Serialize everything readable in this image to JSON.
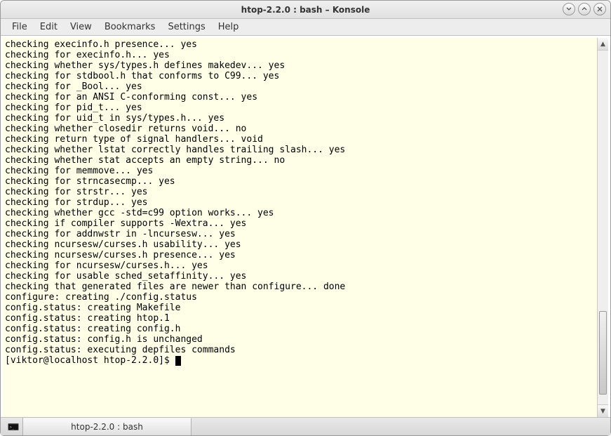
{
  "window": {
    "title": "htop-2.2.0 : bash – Konsole"
  },
  "menu": {
    "items": [
      "File",
      "Edit",
      "View",
      "Bookmarks",
      "Settings",
      "Help"
    ]
  },
  "terminal": {
    "lines": [
      "checking execinfo.h presence... yes",
      "checking for execinfo.h... yes",
      "checking whether sys/types.h defines makedev... yes",
      "checking for stdbool.h that conforms to C99... yes",
      "checking for _Bool... yes",
      "checking for an ANSI C-conforming const... yes",
      "checking for pid_t... yes",
      "checking for uid_t in sys/types.h... yes",
      "checking whether closedir returns void... no",
      "checking return type of signal handlers... void",
      "checking whether lstat correctly handles trailing slash... yes",
      "checking whether stat accepts an empty string... no",
      "checking for memmove... yes",
      "checking for strncasecmp... yes",
      "checking for strstr... yes",
      "checking for strdup... yes",
      "checking whether gcc -std=c99 option works... yes",
      "checking if compiler supports -Wextra... yes",
      "checking for addnwstr in -lncursesw... yes",
      "checking ncursesw/curses.h usability... yes",
      "checking ncursesw/curses.h presence... yes",
      "checking for ncursesw/curses.h... yes",
      "checking for usable sched_setaffinity... yes",
      "checking that generated files are newer than configure... done",
      "configure: creating ./config.status",
      "config.status: creating Makefile",
      "config.status: creating htop.1",
      "config.status: creating config.h",
      "config.status: config.h is unchanged",
      "config.status: executing depfiles commands"
    ],
    "prompt": "[viktor@localhost htop-2.2.0]$ "
  },
  "tabs": {
    "active": "htop-2.2.0 : bash"
  }
}
